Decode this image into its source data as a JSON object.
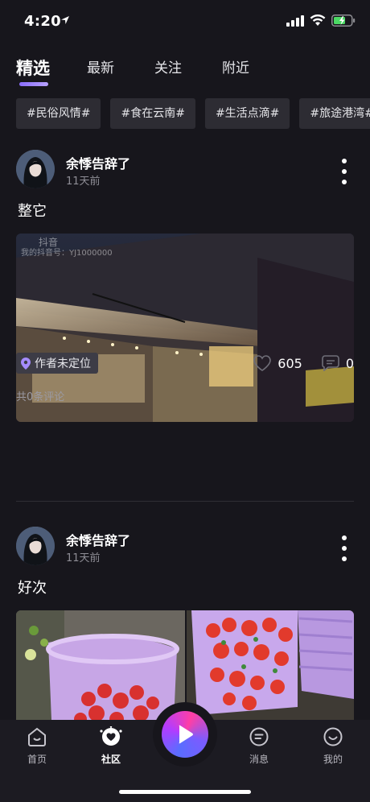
{
  "status_bar": {
    "time": "4:20"
  },
  "tabs": [
    {
      "label": "精选"
    },
    {
      "label": "最新"
    },
    {
      "label": "关注"
    },
    {
      "label": "附近"
    }
  ],
  "topics": [
    "#民俗风情#",
    "#食在云南#",
    "#生活点滴#",
    "#旅途港湾#"
  ],
  "posts": [
    {
      "author": "余悸告辞了",
      "time": "11天前",
      "caption": "整它",
      "watermark_brand": "抖音",
      "watermark_id": "我的抖音号：YJ1000000",
      "location": "作者未定位",
      "likes": "605",
      "comments": "0",
      "comments_summary": "共0条评论"
    },
    {
      "author": "余悸告辞了",
      "time": "11天前",
      "caption": "好次"
    }
  ],
  "nav": {
    "items": [
      {
        "label": "首页",
        "icon": "home-icon"
      },
      {
        "label": "社区",
        "icon": "community-icon"
      },
      {
        "label": "消息",
        "icon": "message-icon"
      },
      {
        "label": "我的",
        "icon": "profile-icon"
      }
    ],
    "center_icon": "play-icon"
  },
  "colors": {
    "accent": "#8a6dff",
    "background": "#17161c",
    "chip": "#2d2c33"
  }
}
